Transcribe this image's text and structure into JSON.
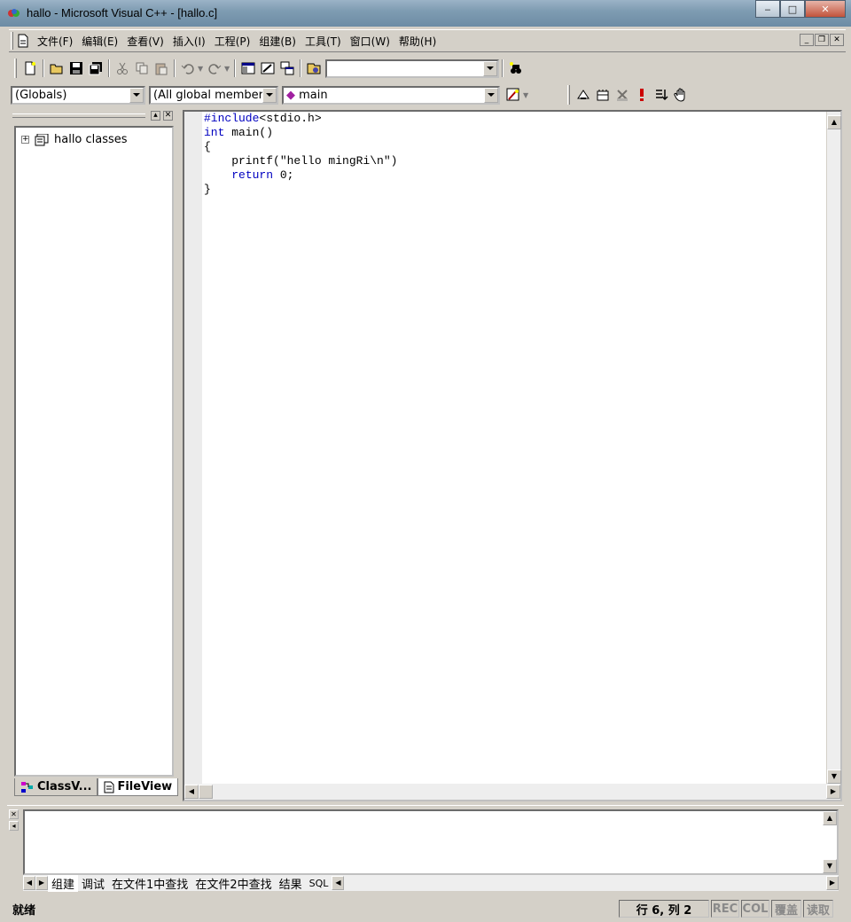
{
  "window": {
    "title": "hallo - Microsoft Visual C++ - [hallo.c]"
  },
  "menu": [
    "文件(F)",
    "编辑(E)",
    "查看(V)",
    "插入(I)",
    "工程(P)",
    "组建(B)",
    "工具(T)",
    "窗口(W)",
    "帮助(H)"
  ],
  "wizardbar": {
    "class_combo": "(Globals)",
    "filter_combo": "(All global members",
    "member_combo": "main"
  },
  "workspace": {
    "tree_root": "hallo classes",
    "tabs": [
      "ClassV...",
      "FileView"
    ]
  },
  "editor": {
    "lines": [
      [
        {
          "t": "#include",
          "k": true
        },
        {
          "t": "<stdio.h>",
          "k": false
        }
      ],
      [
        {
          "t": "int",
          "k": true
        },
        {
          "t": " main()",
          "k": false
        }
      ],
      [
        {
          "t": "{",
          "k": false
        }
      ],
      [
        {
          "t": "    printf(\"hello mingRi\\n\")",
          "k": false
        }
      ],
      [
        {
          "t": "    ",
          "k": false
        },
        {
          "t": "return",
          "k": true
        },
        {
          "t": " 0;",
          "k": false
        }
      ],
      [
        {
          "t": "}",
          "k": false
        }
      ]
    ]
  },
  "output": {
    "tabs": [
      "组建",
      "调试",
      "在文件1中查找",
      "在文件2中查找",
      "结果",
      "SQL"
    ]
  },
  "status": {
    "ready": "就绪",
    "position": "行 6, 列 2",
    "rec": "REC",
    "col": "COL",
    "ovr": "覆盖",
    "read": "读取"
  },
  "colors": {
    "keyword": "#0000c0",
    "chrome": "#d4d0c8"
  }
}
